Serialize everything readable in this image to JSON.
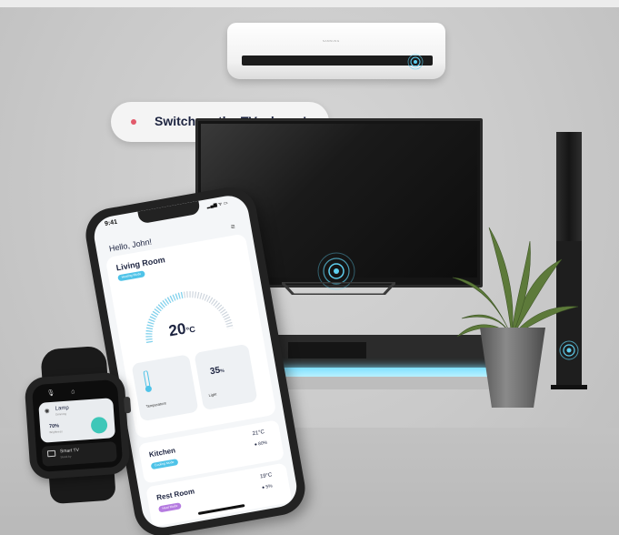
{
  "speech_bubble": {
    "text": "Switch on the TV, please!"
  },
  "ac": {
    "brand": "SAMSUNG"
  },
  "phone": {
    "status_time": "9:41",
    "status_icons": "▂▄▆ ᯤ ▭",
    "greeting": "Hello, John!",
    "living_room": {
      "title": "Living Room",
      "status": "Heating Mode",
      "temperature_value": "20",
      "temperature_unit": "°C",
      "temperature_label": "Temperature",
      "light_value": "35",
      "light_unit": "%",
      "light_label": "Light"
    },
    "rooms": [
      {
        "name": "Kitchen",
        "status": "Cooling Mode",
        "temp": "21°C",
        "humidity": "80%"
      },
      {
        "name": "Rest Room",
        "status": "Heat Mode",
        "temp": "19°C",
        "humidity": "5%"
      }
    ]
  },
  "watch": {
    "lamp_label": "Lamp",
    "lamp_sub": "Dimming",
    "lamp_level": "70%",
    "lamp_level_sub": "Brightness",
    "tv_label": "Smart TV",
    "tv_sub": "Stand-by"
  },
  "colors": {
    "cabinet_glow": "#7fe0ff",
    "pill_blue": "#4fc3e8",
    "pill_purple": "#b57be0",
    "watch_dial": "#3ec7b8",
    "mic_dot": "#e25a6b"
  }
}
